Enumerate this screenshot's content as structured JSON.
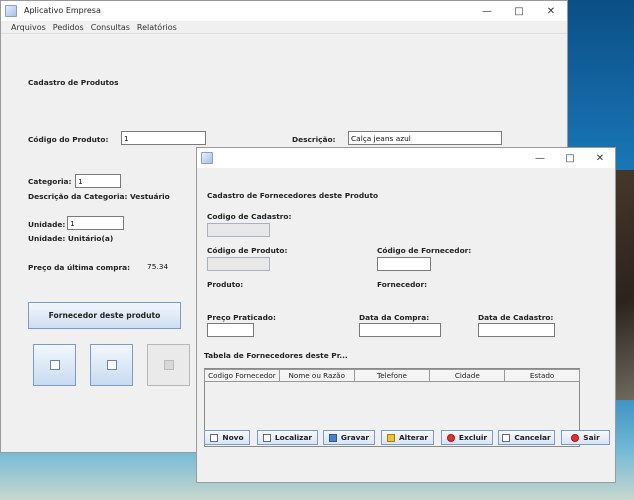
{
  "main_window": {
    "title": "Aplicativo Empresa",
    "menu": [
      "Arquivos",
      "Pedidos",
      "Consultas",
      "Relatórios"
    ],
    "section_title": "Cadastro de Produtos",
    "codigo_label": "Código do Produto:",
    "codigo_value": "1",
    "descricao_label": "Descrição:",
    "descricao_value": "Calça jeans azul",
    "categoria_label": "Categoria:",
    "categoria_value": "1",
    "categoria_desc": "Descrição da Categoria: Vestuário",
    "unidade_label": "Unidade:",
    "unidade_value": "1",
    "unidade_desc": "Unidade: Unitário(a)",
    "preco_label": "Preço da última compra:",
    "preco_value": "75.34",
    "fornecedor_button": "Fornecedor deste produto"
  },
  "dialog": {
    "section_title": "Cadastro de Fornecedores deste Produto",
    "codigo_cadastro_label": "Codigo de Cadastro:",
    "codigo_produto_label": "Código de Produto:",
    "codigo_fornecedor_label": "Código de Fornecedor:",
    "produto_label": "Produto:",
    "fornecedor_label": "Fornecedor:",
    "preco_praticado_label": "Preço Praticado:",
    "data_compra_label": "Data da Compra:",
    "data_cadastro_label": "Data de Cadastro:",
    "table_title": "Tabela de Fornecedores deste Pr...",
    "columns": [
      "Codigo Fornecedor",
      "Nome ou Razão",
      "Telefone",
      "Cidade",
      "Estado"
    ],
    "buttons": {
      "novo": "Novo",
      "localizar": "Localizar",
      "gravar": "Gravar",
      "alterar": "Alterar",
      "excluir": "Excluir",
      "cancelar": "Cancelar",
      "sair": "Sair"
    }
  }
}
